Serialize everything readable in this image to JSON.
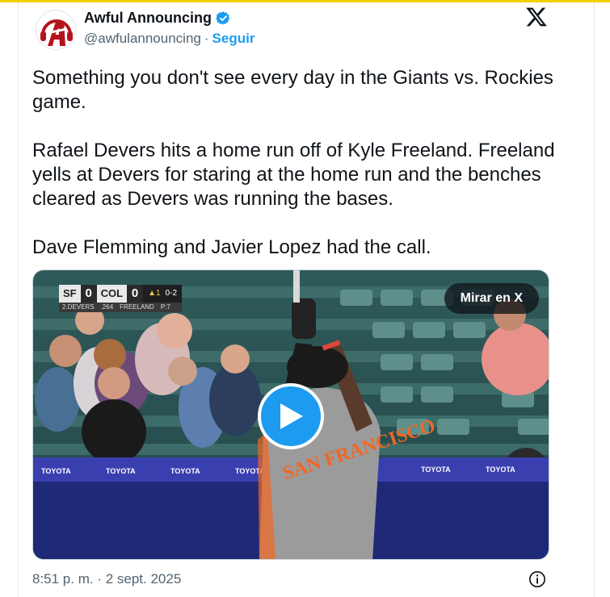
{
  "author": {
    "display_name": "Awful Announcing",
    "handle": "@awfulannouncing",
    "separator": "·",
    "follow_label": "Seguir",
    "avatar_icon": "awful-announcing-logo",
    "verified_icon": "verified-badge-icon"
  },
  "tweet": {
    "paragraphs": [
      "Something you don't see every day in the Giants vs. Rockies game.",
      "Rafael Devers hits a home run off of Kyle Freeland. Freeland yells at Devers for staring at the home run and the benches cleared as Devers was running the bases.",
      "Dave Flemming and Javier Lopez had the call."
    ]
  },
  "media": {
    "watch_label": "Mirar en X",
    "play_icon": "play-icon",
    "scorebug": {
      "away_team": "SF",
      "away_score": "0",
      "home_team": "COL",
      "home_score": "0",
      "inning": "▲1",
      "count": "0-2",
      "batter": "2.DEVERS",
      "batter_stat": ".264",
      "pitcher": "FREELAND",
      "pitcher_stat": "P:7"
    },
    "jersey_text": "SAN FRANCISCO",
    "banner_text": "TOYOTA"
  },
  "footer": {
    "timestamp": "8:51 p. m. · 2 sept. 2025",
    "info_icon": "info-icon"
  },
  "colors": {
    "accent": "#1d9bf0",
    "text": "#0f1419",
    "muted": "#536471",
    "top_accent": "#f5d000",
    "brand_red": "#b5121b"
  }
}
